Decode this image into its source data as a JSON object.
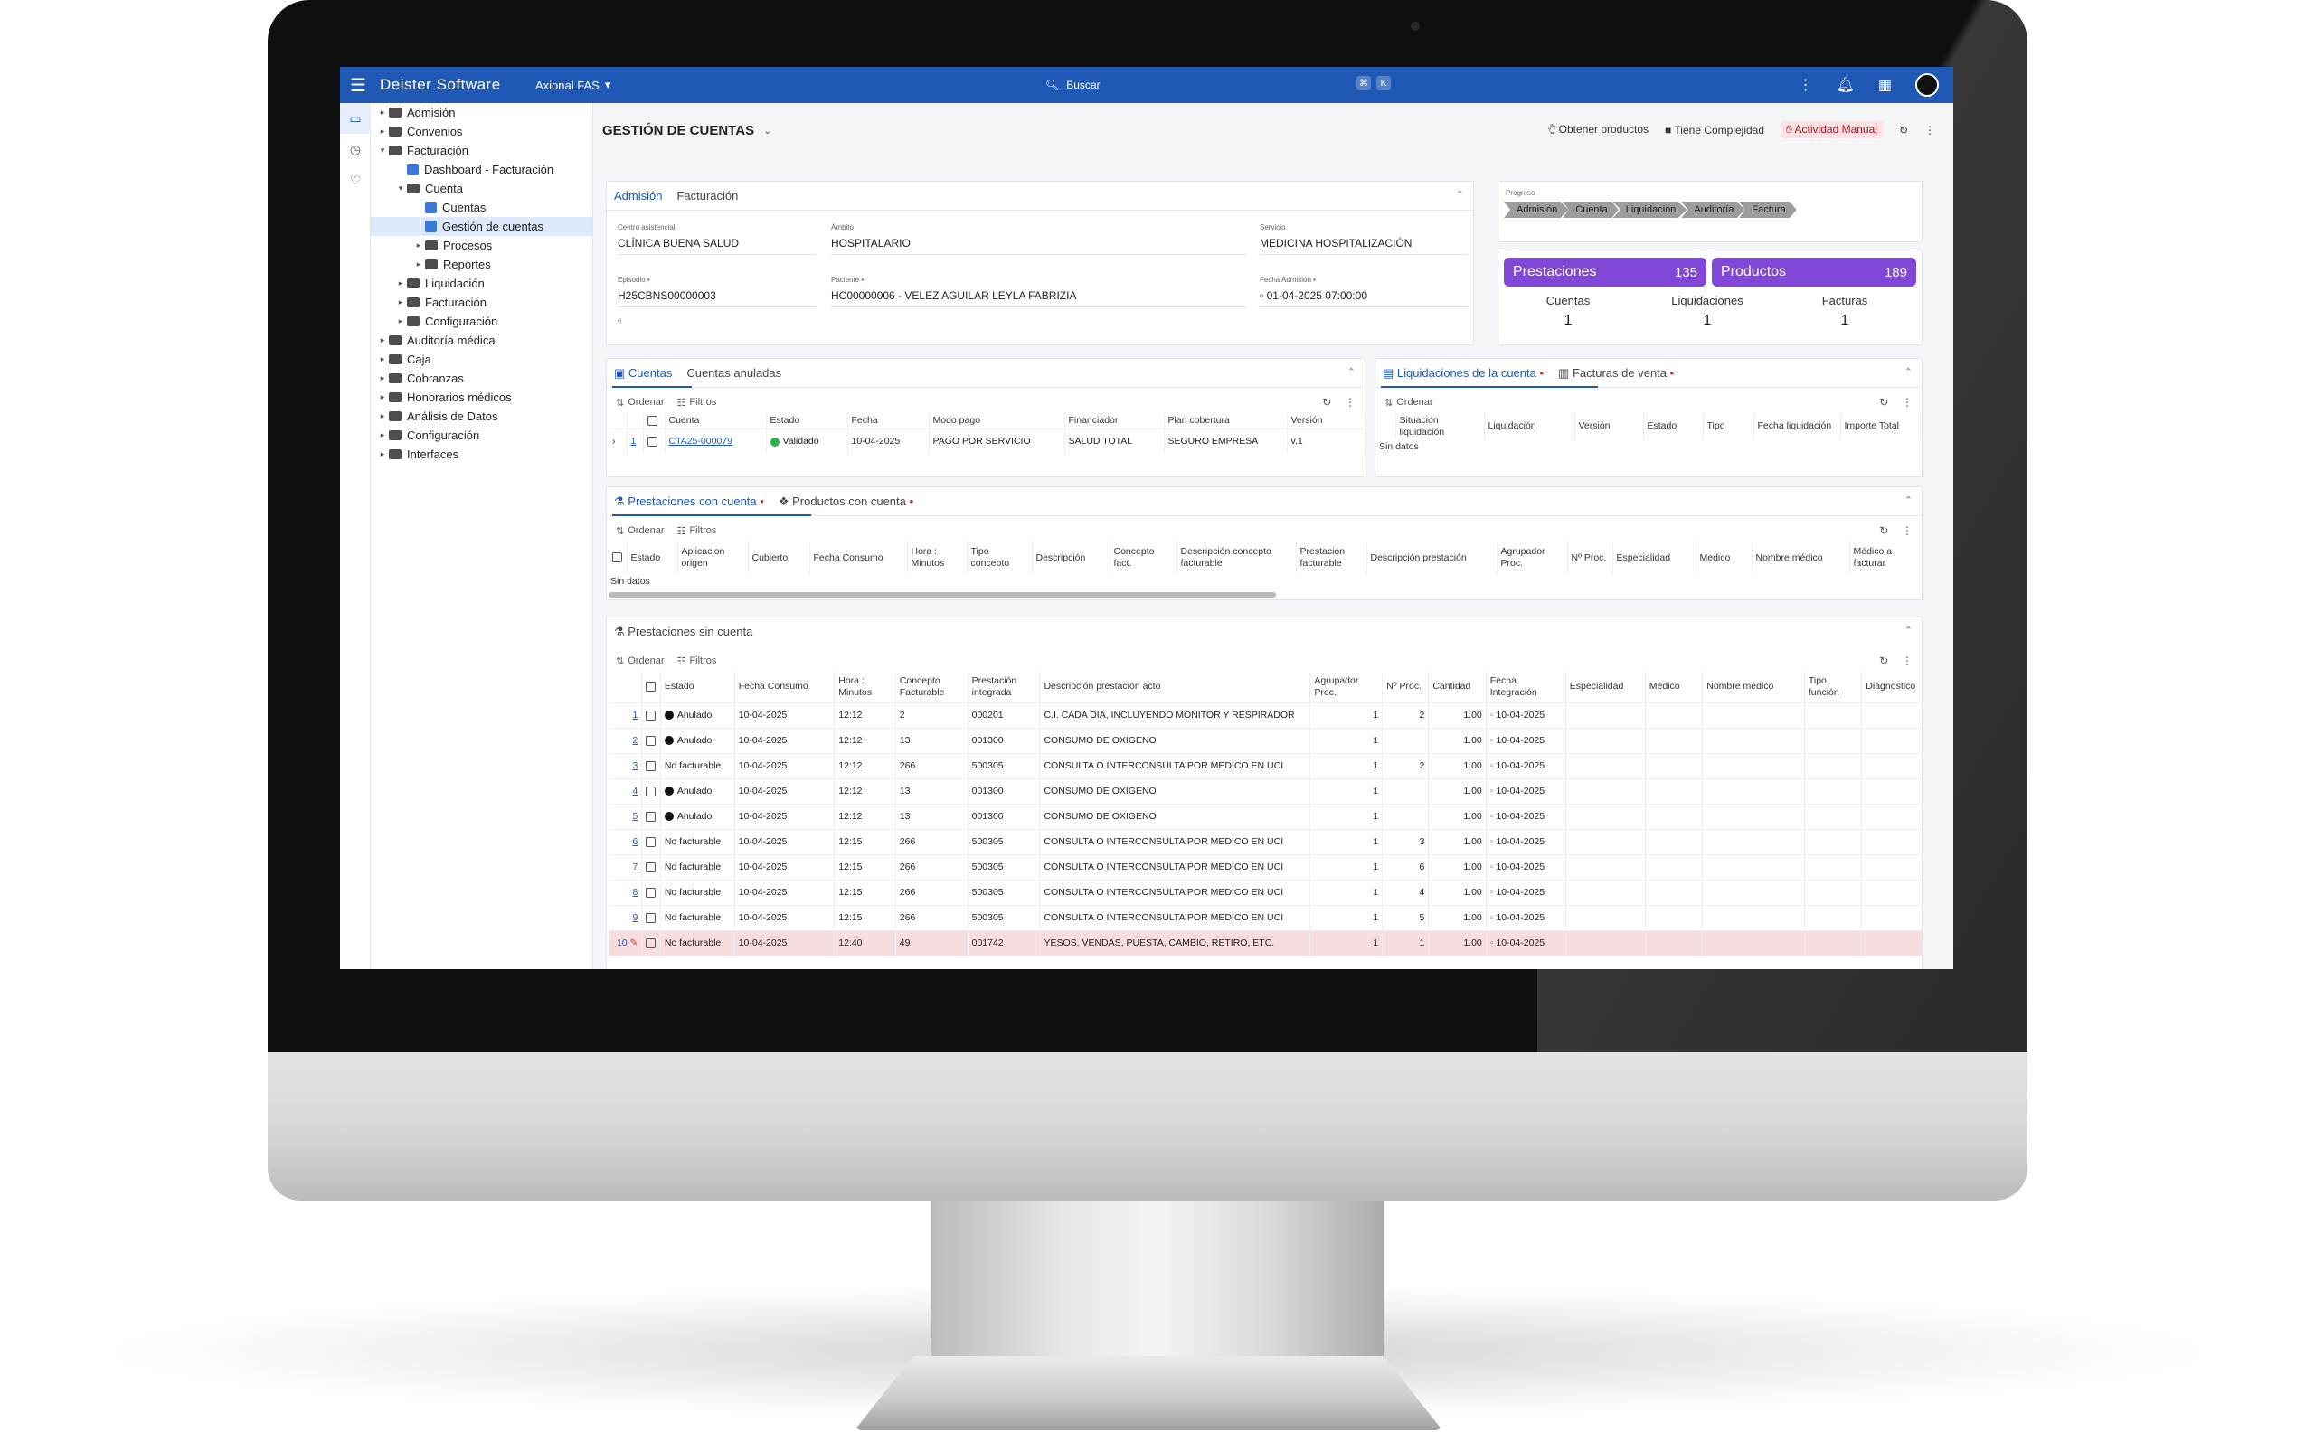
{
  "topbar": {
    "brand": "Deister Software",
    "app": "Axional FAS",
    "search_placeholder": "Buscar",
    "kbd": [
      "⌘",
      "K"
    ]
  },
  "tree": [
    {
      "label": "Admisión",
      "level": 0,
      "type": "folder",
      "caret": "▸"
    },
    {
      "label": "Convenios",
      "level": 0,
      "type": "folder",
      "caret": "▸"
    },
    {
      "label": "Facturación",
      "level": 0,
      "type": "folder",
      "caret": "▾"
    },
    {
      "label": "Dashboard - Facturación",
      "level": 1,
      "type": "doc",
      "caret": ""
    },
    {
      "label": "Cuenta",
      "level": 1,
      "type": "folder",
      "caret": "▾"
    },
    {
      "label": "Cuentas",
      "level": 2,
      "type": "doc",
      "caret": ""
    },
    {
      "label": "Gestión de cuentas",
      "level": 2,
      "type": "doc",
      "caret": "",
      "selected": true
    },
    {
      "label": "Procesos",
      "level": 2,
      "type": "folder",
      "caret": "▸"
    },
    {
      "label": "Reportes",
      "level": 2,
      "type": "folder",
      "caret": "▸"
    },
    {
      "label": "Liquidación",
      "level": 1,
      "type": "folder",
      "caret": "▸"
    },
    {
      "label": "Facturación",
      "level": 1,
      "type": "folder",
      "caret": "▸"
    },
    {
      "label": "Configuración",
      "level": 1,
      "type": "folder",
      "caret": "▸"
    },
    {
      "label": "Auditoría médica",
      "level": 0,
      "type": "folder",
      "caret": "▸"
    },
    {
      "label": "Caja",
      "level": 0,
      "type": "folder",
      "caret": "▸"
    },
    {
      "label": "Cobranzas",
      "level": 0,
      "type": "folder",
      "caret": "▸"
    },
    {
      "label": "Honorarios médicos",
      "level": 0,
      "type": "folder",
      "caret": "▸"
    },
    {
      "label": "Análisis de Datos",
      "level": 0,
      "type": "folder",
      "caret": "▸"
    },
    {
      "label": "Configuración",
      "level": 0,
      "type": "folder",
      "caret": "▸"
    },
    {
      "label": "Interfaces",
      "level": 0,
      "type": "folder",
      "caret": "▸"
    }
  ],
  "page": {
    "title": "GESTIÓN DE CUENTAS",
    "actions": [
      "Obtener productos",
      "Tiene Complejidad",
      "Actividad Manual"
    ]
  },
  "admision": {
    "tabs": [
      "Admisión",
      "Facturación"
    ],
    "centro_label": "Centro asistencial",
    "centro": "CLÍNICA BUENA SALUD",
    "ambito_label": "Ámbito",
    "ambito": "HOSPITALARIO",
    "servicio_label": "Servicio",
    "servicio": "MEDICINA HOSPITALIZACIÓN",
    "episodio_label": "Episodio",
    "episodio": "H25CBNS00000003",
    "paciente_label": "Paciente",
    "paciente": "HC00000006 - VELEZ AGUILAR LEYLA FABRIZIA",
    "fecha_label": "Fecha Admisión",
    "fecha": "01-04-2025 07:00:00",
    "extra": "0"
  },
  "progreso": {
    "label": "Progreso",
    "steps": [
      "Admisión",
      "Cuenta",
      "Liquidación",
      "Auditoría",
      "Factura"
    ]
  },
  "kpis": {
    "prestaciones_label": "Prestaciones",
    "prestaciones": "135",
    "productos_label": "Productos",
    "productos": "189",
    "cuentas_label": "Cuentas",
    "cuentas": "1",
    "liquidaciones_label": "Liquidaciones",
    "liquidaciones": "1",
    "facturas_label": "Facturas",
    "facturas": "1"
  },
  "toolbar": {
    "ordenar": "Ordenar",
    "filtros": "Filtros"
  },
  "cuentas": {
    "tabs": [
      "Cuentas",
      "Cuentas anuladas"
    ],
    "headers": [
      "Cuenta",
      "Estado",
      "Fecha",
      "Modo pago",
      "Financiador",
      "Plan cobertura",
      "Versión"
    ],
    "rows": [
      {
        "n": "1",
        "cuenta": "CTA25-000079",
        "estado": "Validado",
        "fecha": "10-04-2025",
        "modo": "PAGO POR SERVICIO",
        "financiador": "SALUD TOTAL",
        "plan": "SEGURO EMPRESA",
        "version": "v.1"
      }
    ]
  },
  "liquidaciones": {
    "tabs": [
      "Liquidaciones de la cuenta",
      "Facturas de venta"
    ],
    "headers": [
      "Situacion liquidación",
      "Liquidación",
      "Versión",
      "Estado",
      "Tipo",
      "Fecha liquidación",
      "Importe Total"
    ],
    "empty": "Sin datos"
  },
  "prest_con": {
    "tabs": [
      "Prestaciones con cuenta",
      "Productos con cuenta"
    ],
    "headers": [
      "Estado",
      "Aplicacion origen",
      "Cubierto",
      "Fecha Consumo",
      "Hora : Minutos",
      "Tipo concepto",
      "Descripción",
      "Concepto fact.",
      "Descripción concepto facturable",
      "Prestación facturable",
      "Descripción prestación",
      "Agrupador Proc.",
      "Nº Proc.",
      "Especialidad",
      "Medico",
      "Nombre médico",
      "Médico a facturar"
    ],
    "empty": "Sin datos"
  },
  "prest_sin": {
    "title": "Prestaciones sin cuenta",
    "headers": [
      "Estado",
      "Fecha Consumo",
      "Hora : Minutos",
      "Concepto Facturable",
      "Prestación integrada",
      "Descripción prestación acto",
      "Agrupador Proc.",
      "Nº Proc.",
      "Cantidad",
      "Fecha Integración",
      "Especialidad",
      "Medico",
      "Nombre médico",
      "Tipo función",
      "Diagnostico"
    ],
    "rows": [
      {
        "n": "1",
        "estado": "Anulado",
        "dot": true,
        "fecha": "10-04-2025",
        "hora": "12:12",
        "concepto": "2",
        "prest": "000201",
        "desc": "C.I. CADA DIA, INCLUYENDO MONITOR Y RESPIRADOR",
        "agr": "1",
        "proc": "2",
        "cant": "1.00",
        "fint": "10-04-2025"
      },
      {
        "n": "2",
        "estado": "Anulado",
        "dot": true,
        "fecha": "10-04-2025",
        "hora": "12:12",
        "concepto": "13",
        "prest": "001300",
        "desc": "CONSUMO DE OXIGENO",
        "agr": "1",
        "proc": "",
        "cant": "1.00",
        "fint": "10-04-2025"
      },
      {
        "n": "3",
        "estado": "No facturable",
        "dot": false,
        "fecha": "10-04-2025",
        "hora": "12:12",
        "concepto": "266",
        "prest": "500305",
        "desc": "CONSULTA O INTERCONSULTA POR MEDICO EN UCI",
        "agr": "1",
        "proc": "2",
        "cant": "1.00",
        "fint": "10-04-2025"
      },
      {
        "n": "4",
        "estado": "Anulado",
        "dot": true,
        "fecha": "10-04-2025",
        "hora": "12:12",
        "concepto": "13",
        "prest": "001300",
        "desc": "CONSUMO DE OXIGENO",
        "agr": "1",
        "proc": "",
        "cant": "1.00",
        "fint": "10-04-2025"
      },
      {
        "n": "5",
        "estado": "Anulado",
        "dot": true,
        "fecha": "10-04-2025",
        "hora": "12:12",
        "concepto": "13",
        "prest": "001300",
        "desc": "CONSUMO DE OXIGENO",
        "agr": "1",
        "proc": "",
        "cant": "1.00",
        "fint": "10-04-2025"
      },
      {
        "n": "6",
        "estado": "No facturable",
        "dot": false,
        "fecha": "10-04-2025",
        "hora": "12:15",
        "concepto": "266",
        "prest": "500305",
        "desc": "CONSULTA O INTERCONSULTA POR MEDICO EN UCI",
        "agr": "1",
        "proc": "3",
        "cant": "1.00",
        "fint": "10-04-2025"
      },
      {
        "n": "7",
        "estado": "No facturable",
        "dot": false,
        "fecha": "10-04-2025",
        "hora": "12:15",
        "concepto": "266",
        "prest": "500305",
        "desc": "CONSULTA O INTERCONSULTA POR MEDICO EN UCI",
        "agr": "1",
        "proc": "6",
        "cant": "1.00",
        "fint": "10-04-2025"
      },
      {
        "n": "8",
        "estado": "No facturable",
        "dot": false,
        "fecha": "10-04-2025",
        "hora": "12:15",
        "concepto": "266",
        "prest": "500305",
        "desc": "CONSULTA O INTERCONSULTA POR MEDICO EN UCI",
        "agr": "1",
        "proc": "4",
        "cant": "1.00",
        "fint": "10-04-2025"
      },
      {
        "n": "9",
        "estado": "No facturable",
        "dot": false,
        "fecha": "10-04-2025",
        "hora": "12:15",
        "concepto": "266",
        "prest": "500305",
        "desc": "CONSULTA O INTERCONSULTA POR MEDICO EN UCI",
        "agr": "1",
        "proc": "5",
        "cant": "1.00",
        "fint": "10-04-2025"
      },
      {
        "n": "10",
        "estado": "No facturable",
        "dot": false,
        "fecha": "10-04-2025",
        "hora": "12:40",
        "concepto": "49",
        "prest": "001742",
        "desc": "YESOS. VENDAS, PUESTA, CAMBIO, RETIRO, ETC.",
        "agr": "1",
        "proc": "1",
        "cant": "1.00",
        "fint": "10-04-2025",
        "highlight": true
      }
    ]
  },
  "colors": {
    "brand": "#1f58b5",
    "kpi": "#8148d8",
    "highlight_row": "#f7dde0"
  }
}
